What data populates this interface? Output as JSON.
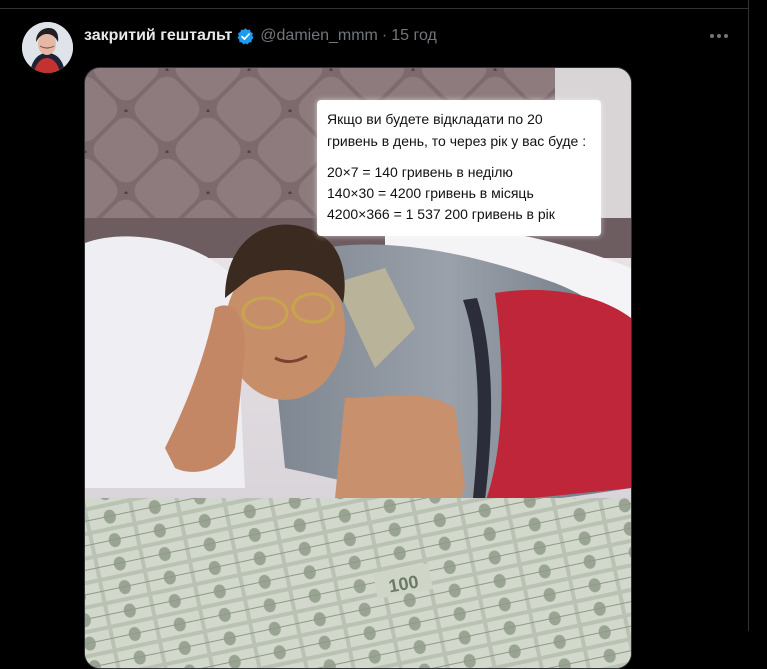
{
  "tweet": {
    "display_name": "закритий гештальт",
    "handle": "@damien_mmm",
    "separator": "·",
    "time": "15 год",
    "verified_color": "#1d9bf0"
  },
  "icons": {
    "verified": "verified-badge-icon",
    "more": "more-options-icon"
  },
  "media": {
    "note": {
      "intro": "Якщо ви будете відкладати по 20 гривень в день, то через рік у вас буде :",
      "line1": "20×7 = 140 гривень в неділю",
      "line2": "140×30 = 4200 гривень в місяць",
      "line3": "4200×366 = 1 537 200 гривень в рік"
    },
    "bill_text": "100"
  }
}
